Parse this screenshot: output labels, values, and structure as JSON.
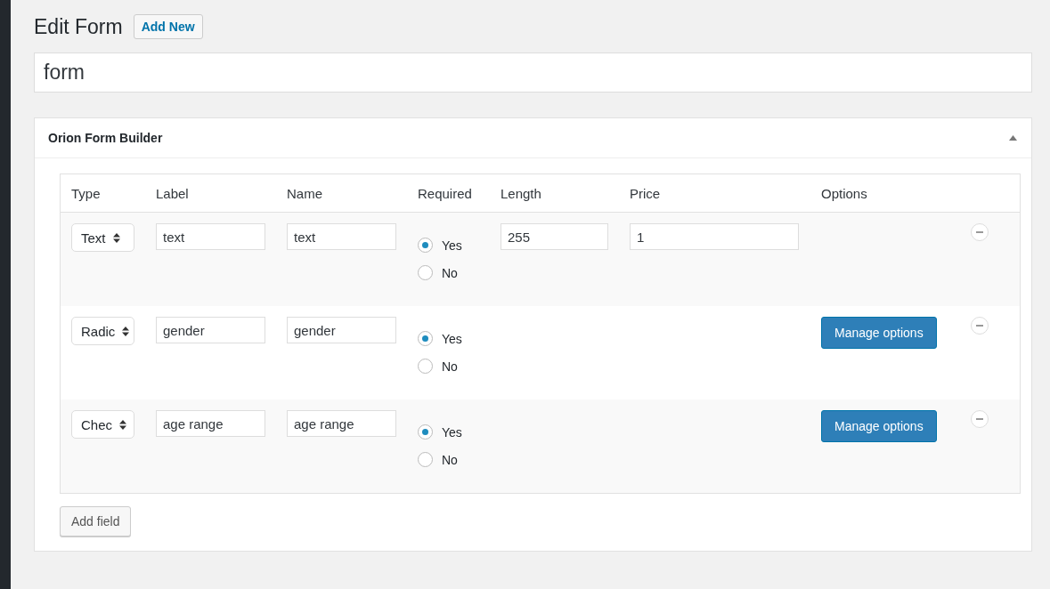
{
  "page": {
    "title": "Edit Form",
    "add_new_button": "Add New"
  },
  "title_field": {
    "value": "form"
  },
  "panel": {
    "title": "Orion Form Builder",
    "expanded": true
  },
  "table": {
    "columns": [
      "Type",
      "Label",
      "Name",
      "Required",
      "Length",
      "Price",
      "Options"
    ],
    "rows": [
      {
        "type": "Text",
        "label": "text",
        "name": "text",
        "required": [
          {
            "label": "Yes",
            "selected": true
          },
          {
            "label": "No",
            "selected": false
          }
        ],
        "length": "255",
        "price": "1"
      },
      {
        "type": "Radic",
        "label": "gender",
        "name": "gender",
        "required": [
          {
            "label": "Yes",
            "selected": true
          },
          {
            "label": "No",
            "selected": false
          }
        ],
        "options_button": "Manage options"
      },
      {
        "type": "Chec",
        "label": "age range",
        "name": "age range",
        "required": [
          {
            "label": "Yes",
            "selected": true
          },
          {
            "label": "No",
            "selected": false
          }
        ],
        "options_button": "Manage options"
      }
    ]
  },
  "add_field_button": "Add field"
}
